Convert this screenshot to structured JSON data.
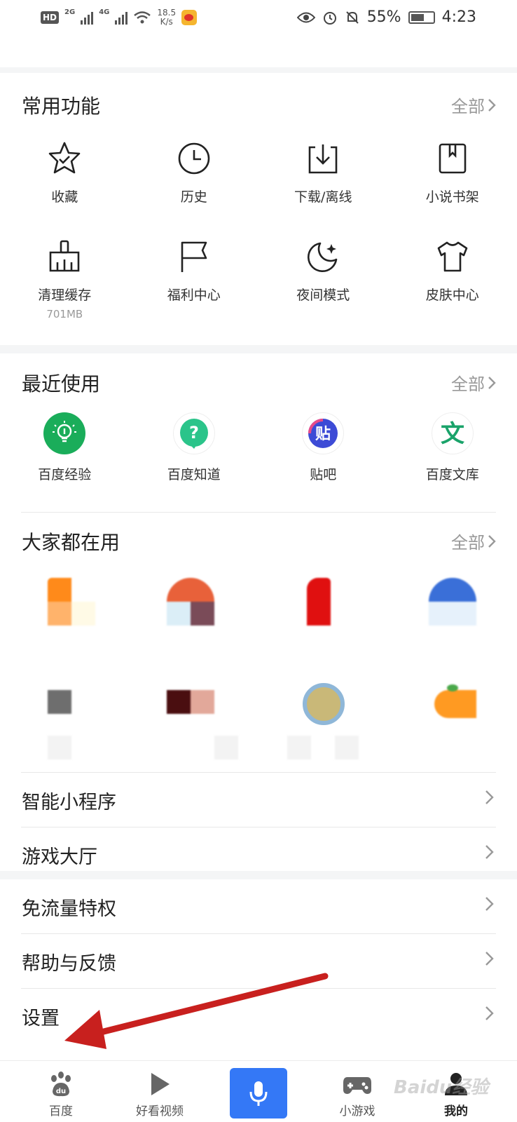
{
  "status_bar": {
    "hd": "HD",
    "sig1_tag": "2G",
    "sig2_tag": "4G",
    "speed_value": "18.5",
    "speed_unit": "K/s",
    "battery": "55%",
    "time": "4:23"
  },
  "common": {
    "title": "常用功能",
    "all": "全部",
    "items": [
      {
        "label": "收藏",
        "icon": "star-icon"
      },
      {
        "label": "历史",
        "icon": "clock-icon"
      },
      {
        "label": "下载/离线",
        "icon": "download-icon"
      },
      {
        "label": "小说书架",
        "icon": "bookmark-icon"
      },
      {
        "label": "清理缓存",
        "sub": "701MB",
        "icon": "broom-icon"
      },
      {
        "label": "福利中心",
        "icon": "flag-icon"
      },
      {
        "label": "夜间模式",
        "icon": "moon-icon"
      },
      {
        "label": "皮肤中心",
        "icon": "tshirt-icon"
      }
    ]
  },
  "recent": {
    "title": "最近使用",
    "all": "全部",
    "items": [
      {
        "label": "百度经验",
        "icon": "bulb-icon",
        "color": "#1aad5a"
      },
      {
        "label": "百度知道",
        "icon": "question-icon",
        "color": "#2bc48a"
      },
      {
        "label": "贴吧",
        "icon": "tieba-icon",
        "color": "#3d4bd6"
      },
      {
        "label": "百度文库",
        "icon": "wenku-icon",
        "color": "#1aa36a"
      }
    ]
  },
  "popular": {
    "title": "大家都在用",
    "all": "全部"
  },
  "list1": [
    {
      "label": "智能小程序"
    },
    {
      "label": "游戏大厅"
    }
  ],
  "list2": [
    {
      "label": "免流量特权"
    },
    {
      "label": "帮助与反馈"
    },
    {
      "label": "设置"
    }
  ],
  "tabs": [
    {
      "label": "百度",
      "icon": "paw-icon"
    },
    {
      "label": "好看视频",
      "icon": "play-icon"
    },
    {
      "label": "",
      "icon": "microphone-icon"
    },
    {
      "label": "小游戏",
      "icon": "gamepad-icon"
    },
    {
      "label": "我的",
      "icon": "user-icon"
    }
  ],
  "colors": {
    "accent": "#3478f6",
    "arrow": "#c8201e"
  },
  "watermark": "Baidu经验"
}
